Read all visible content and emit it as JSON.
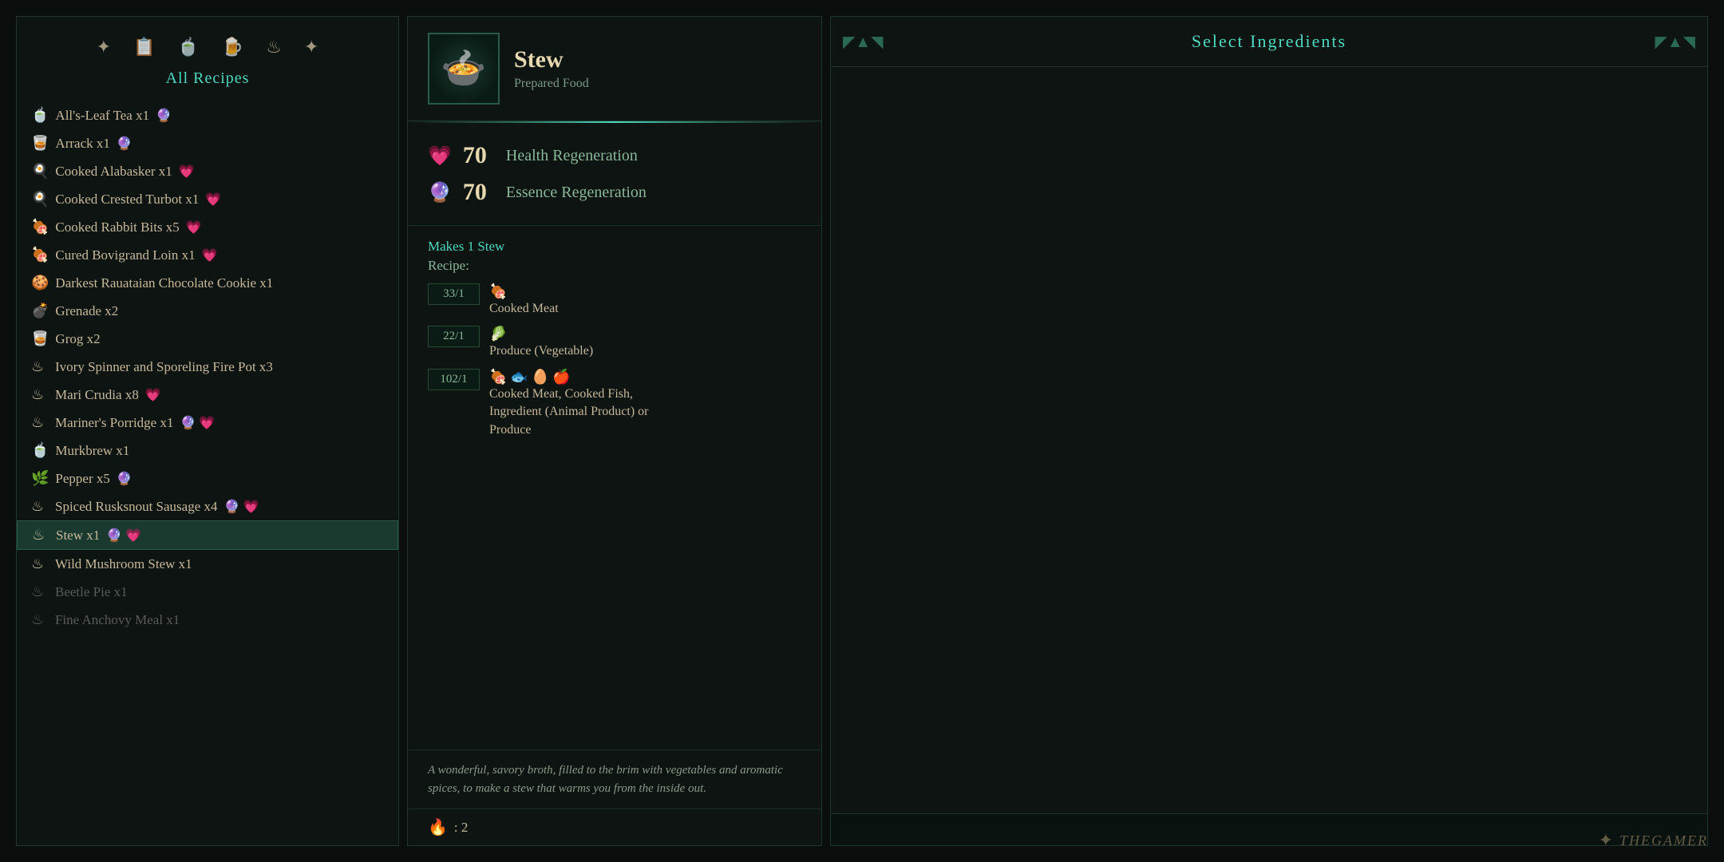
{
  "left_panel": {
    "section_title": "All Recipes",
    "filter_icons": [
      "✦",
      "📋",
      "🍵",
      "🍺",
      "♨",
      "✦"
    ],
    "recipes": [
      {
        "id": 1,
        "icon": "🍵",
        "name": "All's-Leaf Tea",
        "qty": "x1",
        "badges": [
          "essence"
        ],
        "disabled": false
      },
      {
        "id": 2,
        "icon": "🥃",
        "name": "Arrack",
        "qty": "x1",
        "badges": [
          "essence"
        ],
        "disabled": false
      },
      {
        "id": 3,
        "icon": "🍳",
        "name": "Cooked Alabasker",
        "qty": "x1",
        "badges": [
          "heart"
        ],
        "disabled": false
      },
      {
        "id": 4,
        "icon": "🍳",
        "name": "Cooked Crested Turbot",
        "qty": "x1",
        "badges": [
          "heart"
        ],
        "disabled": false
      },
      {
        "id": 5,
        "icon": "🍖",
        "name": "Cooked Rabbit Bits",
        "qty": "x5",
        "badges": [
          "heart"
        ],
        "disabled": false
      },
      {
        "id": 6,
        "icon": "🍖",
        "name": "Cured Bovigrand Loin",
        "qty": "x1",
        "badges": [
          "heart"
        ],
        "disabled": false
      },
      {
        "id": 7,
        "icon": "🍪",
        "name": "Darkest Rauataian Chocolate Cookie",
        "qty": "x1",
        "badges": [],
        "disabled": false
      },
      {
        "id": 8,
        "icon": "💣",
        "name": "Grenade",
        "qty": "x2",
        "badges": [],
        "disabled": false
      },
      {
        "id": 9,
        "icon": "🥃",
        "name": "Grog",
        "qty": "x2",
        "badges": [],
        "disabled": false
      },
      {
        "id": 10,
        "icon": "♨",
        "name": "Ivory Spinner and Sporeling Fire Pot",
        "qty": "x3",
        "badges": [],
        "disabled": false
      },
      {
        "id": 11,
        "icon": "♨",
        "name": "Mari Crudia",
        "qty": "x8",
        "badges": [
          "heart"
        ],
        "disabled": false
      },
      {
        "id": 12,
        "icon": "♨",
        "name": "Mariner's Porridge",
        "qty": "x1",
        "badges": [
          "essence",
          "heart"
        ],
        "disabled": false
      },
      {
        "id": 13,
        "icon": "🍵",
        "name": "Murkbrew",
        "qty": "x1",
        "badges": [],
        "disabled": false
      },
      {
        "id": 14,
        "icon": "🌿",
        "name": "Pepper",
        "qty": "x5",
        "badges": [
          "essence"
        ],
        "disabled": false
      },
      {
        "id": 15,
        "icon": "♨",
        "name": "Spiced Rusksnout Sausage",
        "qty": "x4",
        "badges": [
          "essence",
          "heart"
        ],
        "disabled": false
      },
      {
        "id": 16,
        "icon": "♨",
        "name": "Stew",
        "qty": "x1",
        "badges": [
          "essence",
          "heart"
        ],
        "selected": true,
        "disabled": false
      },
      {
        "id": 17,
        "icon": "♨",
        "name": "Wild Mushroom Stew",
        "qty": "x1",
        "badges": [],
        "disabled": false
      },
      {
        "id": 18,
        "icon": "♨",
        "name": "Beetle Pie",
        "qty": "x1",
        "badges": [],
        "disabled": true
      },
      {
        "id": 19,
        "icon": "♨",
        "name": "Fine Anchovy Meal",
        "qty": "x1",
        "badges": [],
        "disabled": true
      }
    ]
  },
  "middle_panel": {
    "item_name": "Stew",
    "item_subtitle": "Prepared Food",
    "item_icon": "🍲",
    "stats": [
      {
        "icon": "💗",
        "icon_type": "heart",
        "value": "70",
        "label": "Health Regeneration"
      },
      {
        "icon": "🔮",
        "icon_type": "essence",
        "value": "70",
        "label": "Essence Regeneration"
      }
    ],
    "makes_text": "Makes 1 Stew",
    "recipe_label": "Recipe:",
    "ingredients": [
      {
        "count": "33/1",
        "icons": [
          "🍖"
        ],
        "name": "Cooked Meat",
        "detail": ""
      },
      {
        "count": "22/1",
        "icons": [
          "🥬"
        ],
        "name": "Produce (Vegetable)",
        "detail": ""
      },
      {
        "count": "102/1",
        "icons": [
          "🍖",
          "🐟",
          "🥚",
          "🍎"
        ],
        "name": "",
        "detail": "Cooked Meat, Cooked Fish, Ingredient (Animal Product) or Produce"
      }
    ],
    "description": "A wonderful, savory broth, filled to the brim with vegetables and aromatic spices, to make a stew that warms you from the inside out.",
    "craft_icon": "🔥",
    "craft_count": ": 2"
  },
  "right_panel": {
    "title": "Select Ingredients",
    "deco_left": "◤▲◥",
    "deco_right": "◤▲◥"
  },
  "watermark": {
    "icon": "✦",
    "text": "THEGAMER"
  }
}
